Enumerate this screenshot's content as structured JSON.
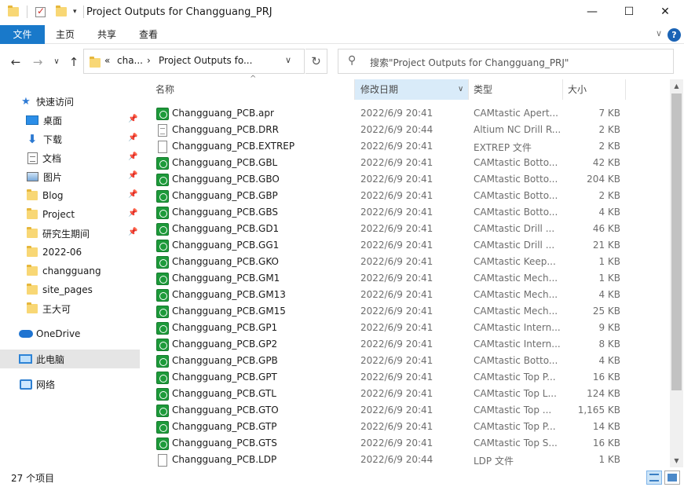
{
  "window": {
    "title": "Project Outputs for Changguang_PRJ",
    "minimize": "—",
    "maximize": "☐",
    "close": "✕"
  },
  "ribbon": {
    "tabs": [
      "文件",
      "主页",
      "共享",
      "查看"
    ],
    "expand": "∨",
    "help": "?"
  },
  "nav": {
    "back": "←",
    "forward": "→",
    "recent": "∨",
    "up": "↑",
    "breadcrumb": [
      "«",
      "cha...",
      "›",
      "Project Outputs fo..."
    ],
    "dropdown": "∨",
    "refresh": "↻",
    "search_placeholder": "搜索\"Project Outputs for Changguang_PRJ\""
  },
  "sidebar": {
    "quick_access": "快速访问",
    "items": [
      {
        "label": "桌面",
        "icon": "desktop-icon",
        "pinned": true
      },
      {
        "label": "下载",
        "icon": "download-icon",
        "pinned": true
      },
      {
        "label": "文档",
        "icon": "documents-icon",
        "pinned": true
      },
      {
        "label": "图片",
        "icon": "pictures-icon",
        "pinned": true
      },
      {
        "label": "Blog",
        "icon": "folder-icon",
        "pinned": true
      },
      {
        "label": "Project",
        "icon": "folder-icon",
        "pinned": true
      },
      {
        "label": "研究生期间",
        "icon": "folder-icon",
        "pinned": true
      },
      {
        "label": "2022-06",
        "icon": "folder-icon",
        "pinned": false
      },
      {
        "label": "changguang",
        "icon": "folder-icon",
        "pinned": false
      },
      {
        "label": "site_pages",
        "icon": "folder-icon",
        "pinned": false
      },
      {
        "label": "王大可",
        "icon": "folder-icon",
        "pinned": false
      }
    ],
    "onedrive": "OneDrive",
    "this_pc": "此电脑",
    "network": "网络"
  },
  "columns": {
    "name": "名称",
    "date": "修改日期",
    "type": "类型",
    "size": "大小",
    "sort_indicator": "^",
    "filter_indicator": "∨"
  },
  "files": [
    {
      "name": "Changguang_PCB.apr",
      "date": "2022/6/9 20:41",
      "type": "CAMtastic Apert...",
      "size": "7 KB",
      "icon": "cam"
    },
    {
      "name": "Changguang_PCB.DRR",
      "date": "2022/6/9 20:44",
      "type": "Altium NC Drill R...",
      "size": "2 KB",
      "icon": "txt"
    },
    {
      "name": "Changguang_PCB.EXTREP",
      "date": "2022/6/9 20:41",
      "type": "EXTREP 文件",
      "size": "2 KB",
      "icon": "blank"
    },
    {
      "name": "Changguang_PCB.GBL",
      "date": "2022/6/9 20:41",
      "type": "CAMtastic Botto...",
      "size": "42 KB",
      "icon": "cam"
    },
    {
      "name": "Changguang_PCB.GBO",
      "date": "2022/6/9 20:41",
      "type": "CAMtastic Botto...",
      "size": "204 KB",
      "icon": "cam"
    },
    {
      "name": "Changguang_PCB.GBP",
      "date": "2022/6/9 20:41",
      "type": "CAMtastic Botto...",
      "size": "2 KB",
      "icon": "cam"
    },
    {
      "name": "Changguang_PCB.GBS",
      "date": "2022/6/9 20:41",
      "type": "CAMtastic Botto...",
      "size": "4 KB",
      "icon": "cam"
    },
    {
      "name": "Changguang_PCB.GD1",
      "date": "2022/6/9 20:41",
      "type": "CAMtastic Drill ...",
      "size": "46 KB",
      "icon": "cam"
    },
    {
      "name": "Changguang_PCB.GG1",
      "date": "2022/6/9 20:41",
      "type": "CAMtastic Drill ...",
      "size": "21 KB",
      "icon": "cam"
    },
    {
      "name": "Changguang_PCB.GKO",
      "date": "2022/6/9 20:41",
      "type": "CAMtastic Keep...",
      "size": "1 KB",
      "icon": "cam"
    },
    {
      "name": "Changguang_PCB.GM1",
      "date": "2022/6/9 20:41",
      "type": "CAMtastic Mech...",
      "size": "1 KB",
      "icon": "cam"
    },
    {
      "name": "Changguang_PCB.GM13",
      "date": "2022/6/9 20:41",
      "type": "CAMtastic Mech...",
      "size": "4 KB",
      "icon": "cam"
    },
    {
      "name": "Changguang_PCB.GM15",
      "date": "2022/6/9 20:41",
      "type": "CAMtastic Mech...",
      "size": "25 KB",
      "icon": "cam"
    },
    {
      "name": "Changguang_PCB.GP1",
      "date": "2022/6/9 20:41",
      "type": "CAMtastic Intern...",
      "size": "9 KB",
      "icon": "cam"
    },
    {
      "name": "Changguang_PCB.GP2",
      "date": "2022/6/9 20:41",
      "type": "CAMtastic Intern...",
      "size": "8 KB",
      "icon": "cam"
    },
    {
      "name": "Changguang_PCB.GPB",
      "date": "2022/6/9 20:41",
      "type": "CAMtastic Botto...",
      "size": "4 KB",
      "icon": "cam"
    },
    {
      "name": "Changguang_PCB.GPT",
      "date": "2022/6/9 20:41",
      "type": "CAMtastic Top P...",
      "size": "16 KB",
      "icon": "cam"
    },
    {
      "name": "Changguang_PCB.GTL",
      "date": "2022/6/9 20:41",
      "type": "CAMtastic Top L...",
      "size": "124 KB",
      "icon": "cam"
    },
    {
      "name": "Changguang_PCB.GTO",
      "date": "2022/6/9 20:41",
      "type": "CAMtastic Top ...",
      "size": "1,165 KB",
      "icon": "cam"
    },
    {
      "name": "Changguang_PCB.GTP",
      "date": "2022/6/9 20:41",
      "type": "CAMtastic Top P...",
      "size": "14 KB",
      "icon": "cam"
    },
    {
      "name": "Changguang_PCB.GTS",
      "date": "2022/6/9 20:41",
      "type": "CAMtastic Top S...",
      "size": "16 KB",
      "icon": "cam"
    },
    {
      "name": "Changguang_PCB.LDP",
      "date": "2022/6/9 20:44",
      "type": "LDP 文件",
      "size": "1 KB",
      "icon": "blank"
    }
  ],
  "status": {
    "item_count": "27 个项目"
  }
}
